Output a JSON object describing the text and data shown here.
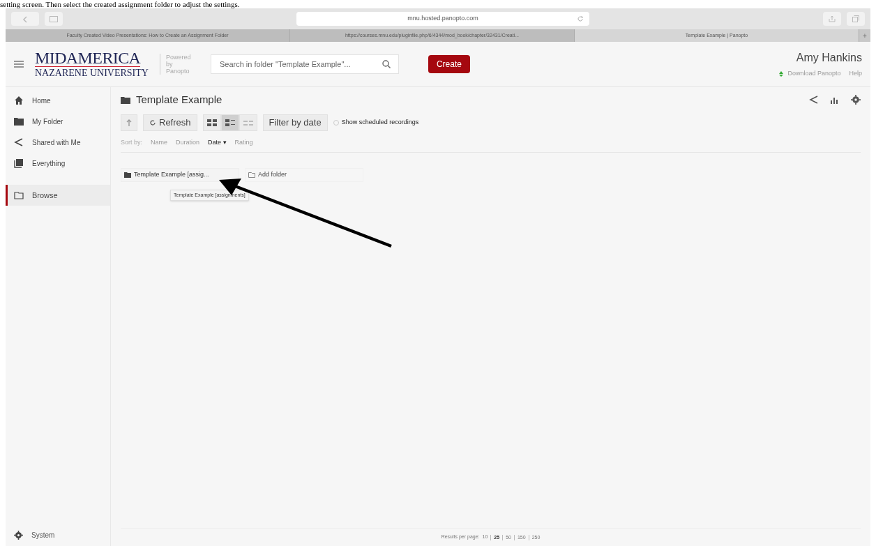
{
  "document_caption": "setting screen.  Then select the created assignment folder to adjust the settings.",
  "browser": {
    "address": "mnu.hosted.panopto.com",
    "tabs": [
      {
        "title": "Faculty Created Video Presentations: How to Create an Assignment Folder",
        "selected": false
      },
      {
        "title": "https://courses.mnu.edu/pluginfile.php/6/4344/mod_book/chapter/32431/Creati...",
        "selected": false
      },
      {
        "title": "Template Example | Panopto",
        "selected": true
      }
    ],
    "new_tab": "+"
  },
  "header": {
    "logo_top": "MIDAMERICA",
    "logo_bottom": "NAZARENE UNIVERSITY",
    "powered_by": "Powered by Panopto",
    "search_placeholder": "Search in folder \"Template Example\"...",
    "create_button": "Create",
    "user_name": "Amy Hankins",
    "download_link": "Download Panopto",
    "help_link": "Help"
  },
  "sidebar": {
    "items": [
      {
        "label": "Home",
        "kind": "home",
        "selected": false
      },
      {
        "label": "My Folder",
        "kind": "folder",
        "selected": false
      },
      {
        "label": "Shared with Me",
        "kind": "share",
        "selected": false
      },
      {
        "label": "Everything",
        "kind": "stack",
        "selected": false
      },
      {
        "label": "Browse",
        "kind": "folder-outline",
        "selected": true
      }
    ],
    "system": "System"
  },
  "content": {
    "title": "Template Example",
    "refresh": "Refresh",
    "views": [
      {
        "kind": "grid",
        "selected": false
      },
      {
        "kind": "detail",
        "selected": true
      },
      {
        "kind": "list",
        "selected": false
      }
    ],
    "filter": "Filter by date",
    "show_scheduled": {
      "label": "Show scheduled recordings",
      "checked": false
    },
    "sort_label": "Sort by:",
    "sort_options": [
      {
        "label": "Name",
        "selected": false
      },
      {
        "label": "Duration",
        "selected": false
      },
      {
        "label": "Date ▾",
        "selected": true
      },
      {
        "label": "Rating",
        "selected": false
      }
    ],
    "folder": "Template Example [assig...",
    "add_folder": "Add folder",
    "tooltip": "Template Example [assignments]",
    "results_label": "Results per page:",
    "page_sizes": [
      {
        "label": "10",
        "selected": false
      },
      {
        "label": "25",
        "selected": true
      },
      {
        "label": "50",
        "selected": false
      },
      {
        "label": "150",
        "selected": false
      },
      {
        "label": "250",
        "selected": false
      }
    ]
  }
}
